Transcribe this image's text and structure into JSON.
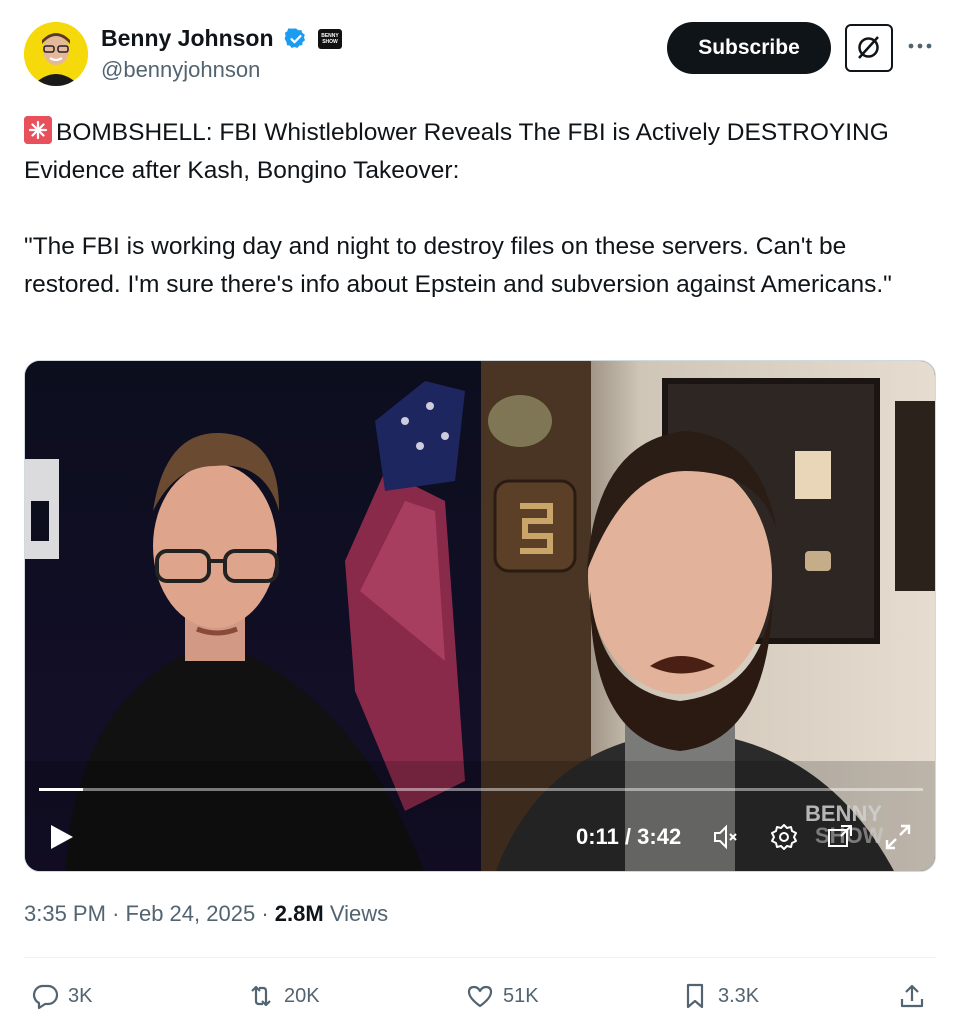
{
  "author": {
    "display_name": "Benny Johnson",
    "handle": "@bennyjohnson",
    "verified": true,
    "affiliation_badge_text": "BENNY SHOW"
  },
  "header": {
    "subscribe_label": "Subscribe",
    "grok_icon": "grok-icon",
    "more_icon": "more-icon"
  },
  "tweet": {
    "emoji": "rotating-light-icon",
    "text": "BOMBSHELL: FBI Whistleblower Reveals The FBI is Actively DESTROYING Evidence after Kash, Bongino Takeover:\n\n\"The FBI is working day and night to destroy files on these servers. Can't be restored. I'm sure there's info about Epstein and subversion against Americans.\""
  },
  "video": {
    "current_time": "0:11",
    "duration": "3:42",
    "time_display": "0:11 / 3:42",
    "progress": 0.05,
    "watermark": "BENNY SHOW",
    "controls": [
      "play-icon",
      "mute-icon",
      "settings-icon",
      "pip-icon",
      "fullscreen-icon"
    ]
  },
  "meta": {
    "time": "3:35 PM",
    "date": "Feb 24, 2025",
    "views_count": "2.8M",
    "views_label": "Views"
  },
  "actions": {
    "replies": "3K",
    "reposts": "20K",
    "likes": "51K",
    "bookmarks": "3.3K"
  },
  "colors": {
    "text": "#0f1419",
    "secondary": "#536471",
    "verified": "#1d9bf0",
    "button_bg": "#0f1419"
  }
}
